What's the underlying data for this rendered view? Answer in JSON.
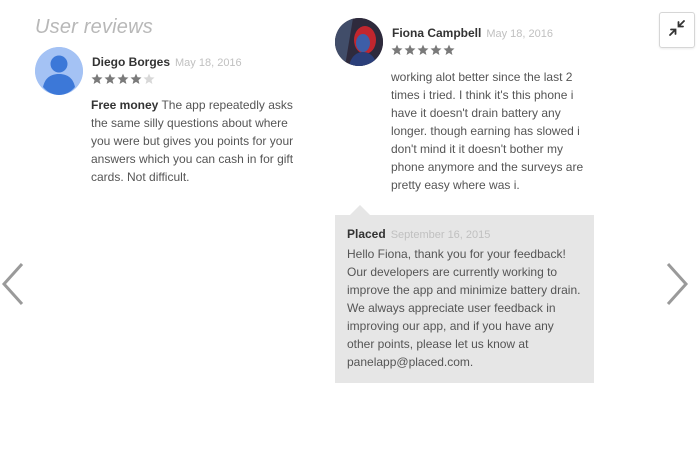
{
  "section_title": "User reviews",
  "colors": {
    "star_filled": "#7a7a7a",
    "star_empty": "#d8d8d8",
    "reply_background": "#e6e6e6",
    "date_text": "#c0c0c0",
    "title_text": "#b8b8b8"
  },
  "icons": {
    "collapse": "collapse-arrows-icon",
    "prev": "chevron-left-icon",
    "next": "chevron-right-icon"
  },
  "reviews": [
    {
      "author": "Diego Borges",
      "date": "May 18, 2016",
      "rating": 4,
      "max_rating": 5,
      "title": "Free money",
      "body": " The app repeatedly asks the same silly questions about where you were but gives you points for your answers which you can cash in for gift cards. Not difficult."
    },
    {
      "author": "Fiona Campbell",
      "date": "May 18, 2016",
      "rating": 5,
      "max_rating": 5,
      "title": "",
      "body": "working alot better since the last 2 times i tried. I think it's this phone i have it doesn't drain battery any longer. though earning has slowed i don't mind it it doesn't bother my phone anymore and the surveys are pretty easy where was i.",
      "reply": {
        "author": "Placed",
        "date": "September 16, 2015",
        "text": "Hello Fiona, thank you for your feedback! Our developers are currently working to improve the app and minimize battery drain. We always appreciate user feedback in improving our app, and if you have any other points, please let us know at panelapp@placed.com."
      }
    }
  ]
}
